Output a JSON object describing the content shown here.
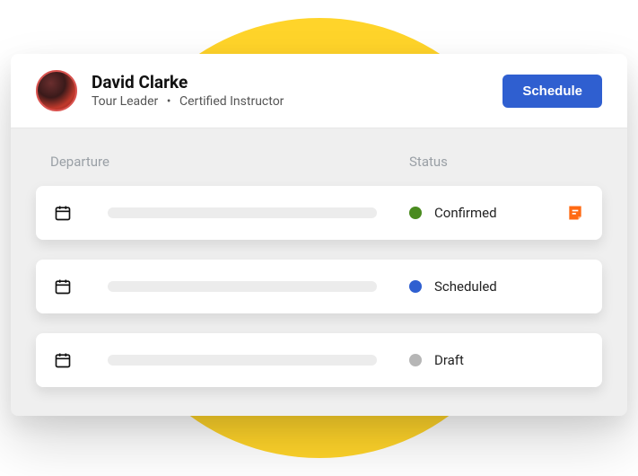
{
  "profile": {
    "name": "David Clarke",
    "role": "Tour Leader",
    "badge": "Certified Instructor"
  },
  "actions": {
    "schedule_label": "Schedule"
  },
  "columns": {
    "departure": "Departure",
    "status": "Status"
  },
  "status_colors": {
    "confirmed": "#4a8b1f",
    "scheduled": "#2f5fd0",
    "draft": "#b6b6b6"
  },
  "rows": [
    {
      "status_key": "confirmed",
      "status_label": "Confirmed",
      "has_note": true
    },
    {
      "status_key": "scheduled",
      "status_label": "Scheduled",
      "has_note": false
    },
    {
      "status_key": "draft",
      "status_label": "Draft",
      "has_note": false
    }
  ]
}
